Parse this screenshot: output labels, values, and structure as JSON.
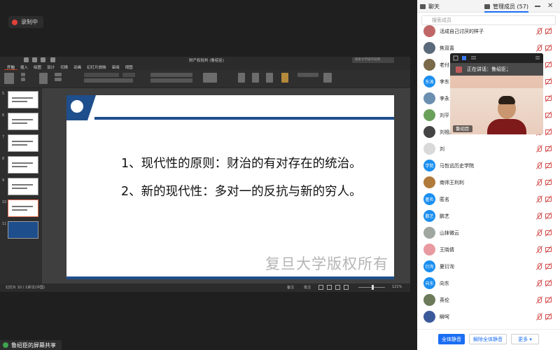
{
  "recording": {
    "label": "录制中"
  },
  "share": {
    "label": "鲁绍臣的屏幕共享"
  },
  "ppt": {
    "title": "财产权批判 (鲁绍臣)",
    "search_placeholder": "搜索文字操作说明",
    "tabs": [
      "开始",
      "插入",
      "绘图",
      "设计",
      "切换",
      "动画",
      "幻灯片放映",
      "审阅",
      "视图"
    ],
    "slide": {
      "line1": "1、现代性的原则：财治的有对存在的统治。",
      "line2": "2、新的现代性：多对一的反抗与新的穷人。",
      "watermark": "复旦大学版权所有"
    },
    "thumb_numbers": [
      "5",
      "6",
      "7",
      "8",
      "9",
      "10",
      "11"
    ],
    "status": {
      "slide_indicator": "幻灯片 10 / 11",
      "language": "中文(中国)",
      "notes": "备注",
      "comments": "批注",
      "zoom": "121%"
    }
  },
  "panel": {
    "tabs": {
      "chat": "聊天",
      "members": "管理成员 (57)"
    },
    "search_placeholder": "搜索成员",
    "members": [
      {
        "name": "活成自己讨厌的样子",
        "avatar_text": "",
        "avatar_color": "#c06666"
      },
      {
        "name": "焦双喜",
        "avatar_text": "",
        "avatar_color": "#5a6a7a"
      },
      {
        "name": "老付",
        "avatar_text": "",
        "avatar_color": "#7a6a4a"
      },
      {
        "name": "李东",
        "avatar_text": "东涛",
        "avatar_color": "#1b8ff0"
      },
      {
        "name": "李永",
        "avatar_text": "",
        "avatar_color": "#6b8fb0"
      },
      {
        "name": "刘平",
        "avatar_text": "",
        "avatar_color": "#6aa15a"
      },
      {
        "name": "刘祖威",
        "avatar_text": "",
        "avatar_color": "#444444"
      },
      {
        "name": "刘",
        "avatar_text": "",
        "avatar_color": "#d9d9d9"
      },
      {
        "name": "马哲远历史学院",
        "avatar_text": "学院",
        "avatar_color": "#1b8ff0"
      },
      {
        "name": "南师王利利",
        "avatar_text": "",
        "avatar_color": "#b07a3a"
      },
      {
        "name": "匿名",
        "avatar_text": "匿名",
        "avatar_color": "#1b8ff0"
      },
      {
        "name": "鹏艺",
        "avatar_text": "鹏艺",
        "avatar_color": "#1b8ff0"
      },
      {
        "name": "山抹微云",
        "avatar_text": "",
        "avatar_color": "#a0a6a0"
      },
      {
        "name": "王晓倩",
        "avatar_text": "",
        "avatar_color": "#e89aa0"
      },
      {
        "name": "夏衍洵",
        "avatar_text": "衍洵",
        "avatar_color": "#1b8ff0"
      },
      {
        "name": "向东",
        "avatar_text": "向东",
        "avatar_color": "#1b8ff0"
      },
      {
        "name": "英伦",
        "avatar_text": "",
        "avatar_color": "#6c7a5a"
      },
      {
        "name": "瞬呵",
        "avatar_text": "",
        "avatar_color": "#3a5a9a"
      }
    ],
    "video": {
      "speaking": "正在讲话：鲁绍臣；",
      "name": "鲁绍臣"
    },
    "footer": {
      "mute_all": "全体静音",
      "unmute_all": "解除全体静音",
      "more": "更多 ▾"
    }
  }
}
